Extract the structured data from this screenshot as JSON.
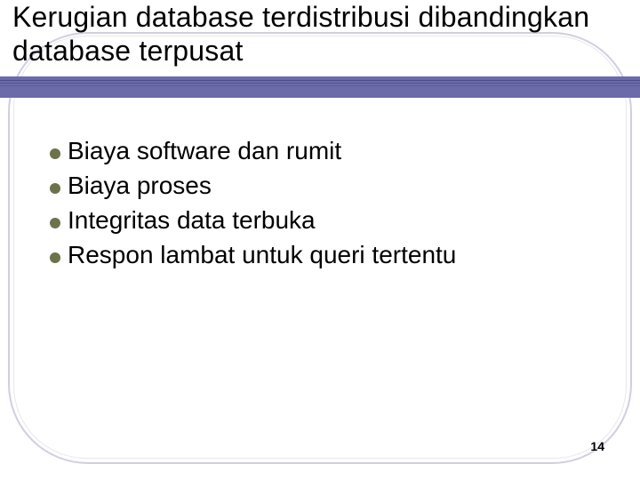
{
  "title": "Kerugian database terdistribusi dibandingkan database terpusat",
  "bullets": [
    "Biaya software dan rumit",
    "Biaya proses",
    "Integritas data terbuka",
    "Respon lambat untuk queri tertentu"
  ],
  "page_number": "14"
}
